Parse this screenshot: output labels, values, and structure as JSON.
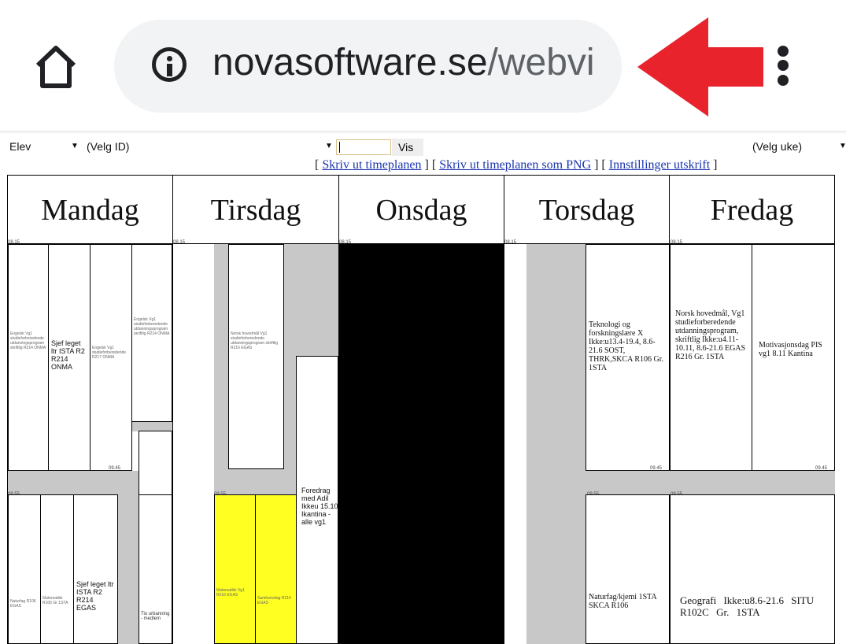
{
  "browser": {
    "url_host": "novasoftware.se",
    "url_path": "/webvi"
  },
  "toolbar": {
    "type_select": "Elev",
    "id_select": "(Velg ID)",
    "vis_button": "Vis",
    "week_select": "(Velg uke)"
  },
  "links": {
    "print": "Skriv ut timeplanen",
    "print_png": "Skriv ut timeplanen som PNG",
    "settings": "Innstillinger utskrift"
  },
  "days": [
    "Mandag",
    "Tirsdag",
    "Onsdag",
    "Torsdag",
    "Fredag"
  ],
  "times": {
    "t0815": "08.15",
    "t0945": "09.45",
    "t0955": "09.55"
  },
  "mandag": {
    "block1": "Sjef leget ltr ISTA R2 R214 ONMA",
    "block2": "Sjef leget ltr ISTA R2 R214 EGAS",
    "block3": "Tio urbanning - medlem"
  },
  "tirsdag": {
    "foredrag": "Foredrag med Adil Ikkeu 15.10 Ikantina - alle vg1"
  },
  "torsdag": {
    "teknologi": "Teknologi og forskningslære X Ikke:u13.4-19.4, 8.6-21.6 SOST, THRK,SKCA R106 Gr. 1STA",
    "naturfag": "Naturfag/kjemi 1STA SKCA R106"
  },
  "fredag": {
    "norsk": "Norsk hovedmål, Vg1 studieforberedende utdanningsprogram, skriftlig Ikke:u4.11-10.11, 8.6-21.6 EGAS R216 Gr. 1STA",
    "motivasjon": "Motivasjonsdag PIS vg1 8.11 Kantina",
    "geografi": "Geografi Ikke:u8.6-21.6 SITU R102C Gr. 1STA"
  },
  "colors": {
    "arrow": "#e8232c",
    "highlight": "#ffff22",
    "link": "#1a35b0",
    "block_gray": "#c8c8c8",
    "onsdag_fill": "#000000"
  }
}
